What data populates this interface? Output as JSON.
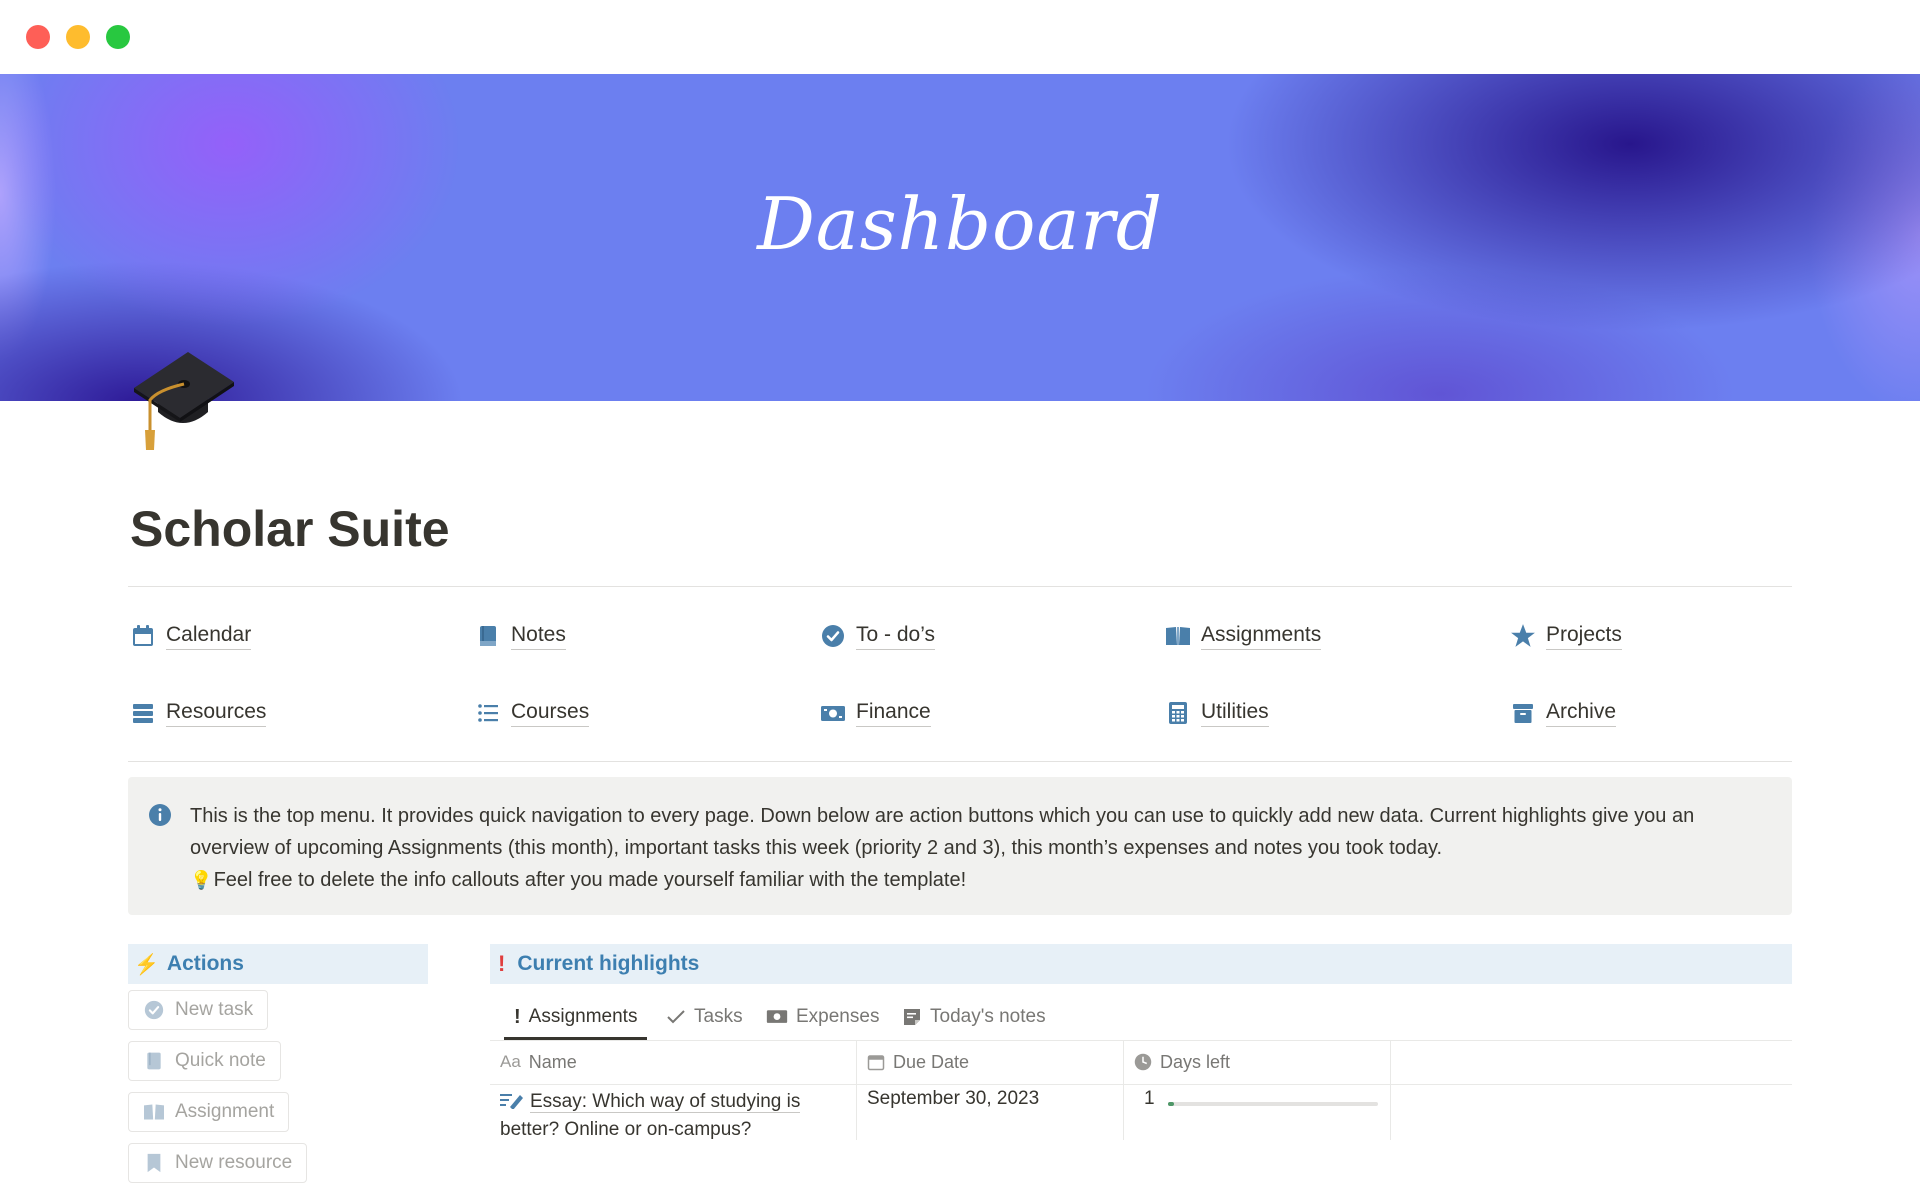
{
  "window": {
    "controls": [
      "close",
      "minimize",
      "zoom"
    ]
  },
  "cover": {
    "title": "Dashboard"
  },
  "page": {
    "icon": "graduation-cap-icon",
    "title": "Scholar Suite"
  },
  "nav": {
    "items": [
      {
        "label": "Calendar",
        "icon": "calendar-icon"
      },
      {
        "label": "Notes",
        "icon": "notebook-icon"
      },
      {
        "label": "To - do’s",
        "icon": "check-circle-icon"
      },
      {
        "label": "Assignments",
        "icon": "open-book-icon"
      },
      {
        "label": "Projects",
        "icon": "star-icon"
      },
      {
        "label": "Resources",
        "icon": "stack-icon"
      },
      {
        "label": "Courses",
        "icon": "list-icon"
      },
      {
        "label": "Finance",
        "icon": "money-icon"
      },
      {
        "label": "Utilities",
        "icon": "calculator-icon"
      },
      {
        "label": "Archive",
        "icon": "archive-icon"
      }
    ]
  },
  "callout": {
    "icon": "info-icon",
    "line1": "This is the top menu. It provides quick navigation to every page. Down below are action buttons which you can use to quickly add new data. Current highlights give you an overview of upcoming Assignments (this month), important tasks this week (priority 2 and 3), this month’s expenses and notes you took today.",
    "line2": "Feel free to delete the info callouts after you made yourself familiar with the template!"
  },
  "actions": {
    "title": "Actions",
    "buttons": [
      {
        "label": "New task",
        "icon": "check-circle-icon"
      },
      {
        "label": "Quick note",
        "icon": "notebook-icon"
      },
      {
        "label": "Assignment",
        "icon": "open-book-icon"
      },
      {
        "label": "New resource",
        "icon": "bookmark-icon"
      }
    ]
  },
  "highlights": {
    "title": "Current highlights",
    "tabs": [
      {
        "label": "Assignments",
        "icon": "exclamation-icon",
        "active": true
      },
      {
        "label": "Tasks",
        "icon": "checkmark-icon",
        "active": false
      },
      {
        "label": "Expenses",
        "icon": "money-icon",
        "active": false
      },
      {
        "label": "Today's notes",
        "icon": "note-icon",
        "active": false
      }
    ],
    "table": {
      "columns": [
        {
          "label": "Name",
          "icon": "Aa"
        },
        {
          "label": "Due Date",
          "icon": "calendar-icon"
        },
        {
          "label": "Days left",
          "icon": "clock-icon"
        }
      ],
      "rows": [
        {
          "name": "Essay: Which way of studying is better? Online or on-campus?",
          "due": "September 30, 2023",
          "days_left": "1",
          "progress": 0.02
        }
      ]
    }
  },
  "colors": {
    "accent": "#3d7fb0",
    "icon": "#4a7faa",
    "progress": "#4f9768"
  }
}
